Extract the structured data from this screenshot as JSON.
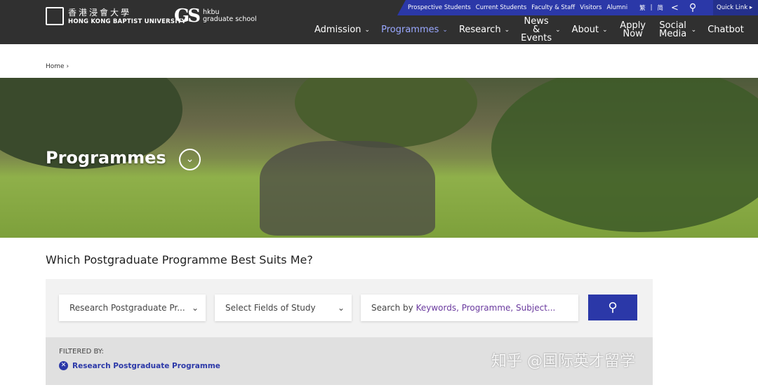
{
  "header": {
    "logo_zh": "香港浸會大學",
    "logo_en": "HONG KONG BAPTIST UNIVERSITY",
    "gs_mark": "GS",
    "gs_line1": "hkbu",
    "gs_line2": "graduate school"
  },
  "topbar": {
    "links": [
      "Prospective Students",
      "Current Students",
      "Faculty & Staff",
      "Visitors",
      "Alumni"
    ],
    "lang_trad": "繁",
    "lang_sep": "|",
    "lang_simp": "简",
    "quick_link": "Quick Link ▸"
  },
  "nav": [
    {
      "label": "Admission"
    },
    {
      "label": "Programmes"
    },
    {
      "label": "Research"
    },
    {
      "label": "News & Events"
    },
    {
      "label": "About"
    },
    {
      "label": "Apply Now"
    },
    {
      "label": "Social Media"
    },
    {
      "label": "Chatbot"
    }
  ],
  "breadcrumb": {
    "home": "Home"
  },
  "hero": {
    "title": "Programmes"
  },
  "finder": {
    "question": "Which Postgraduate Programme Best Suits Me?",
    "programme_type": "Research Postgraduate Pr...",
    "fields": "Select Fields of Study",
    "search_prefix": "Search by ",
    "search_hint": "Keywords, Programme, Subject...",
    "filtered_by": "FILTERED BY:",
    "filter_chip": "Research Postgraduate Programme"
  },
  "watermark": "知乎 @国际英才留学"
}
